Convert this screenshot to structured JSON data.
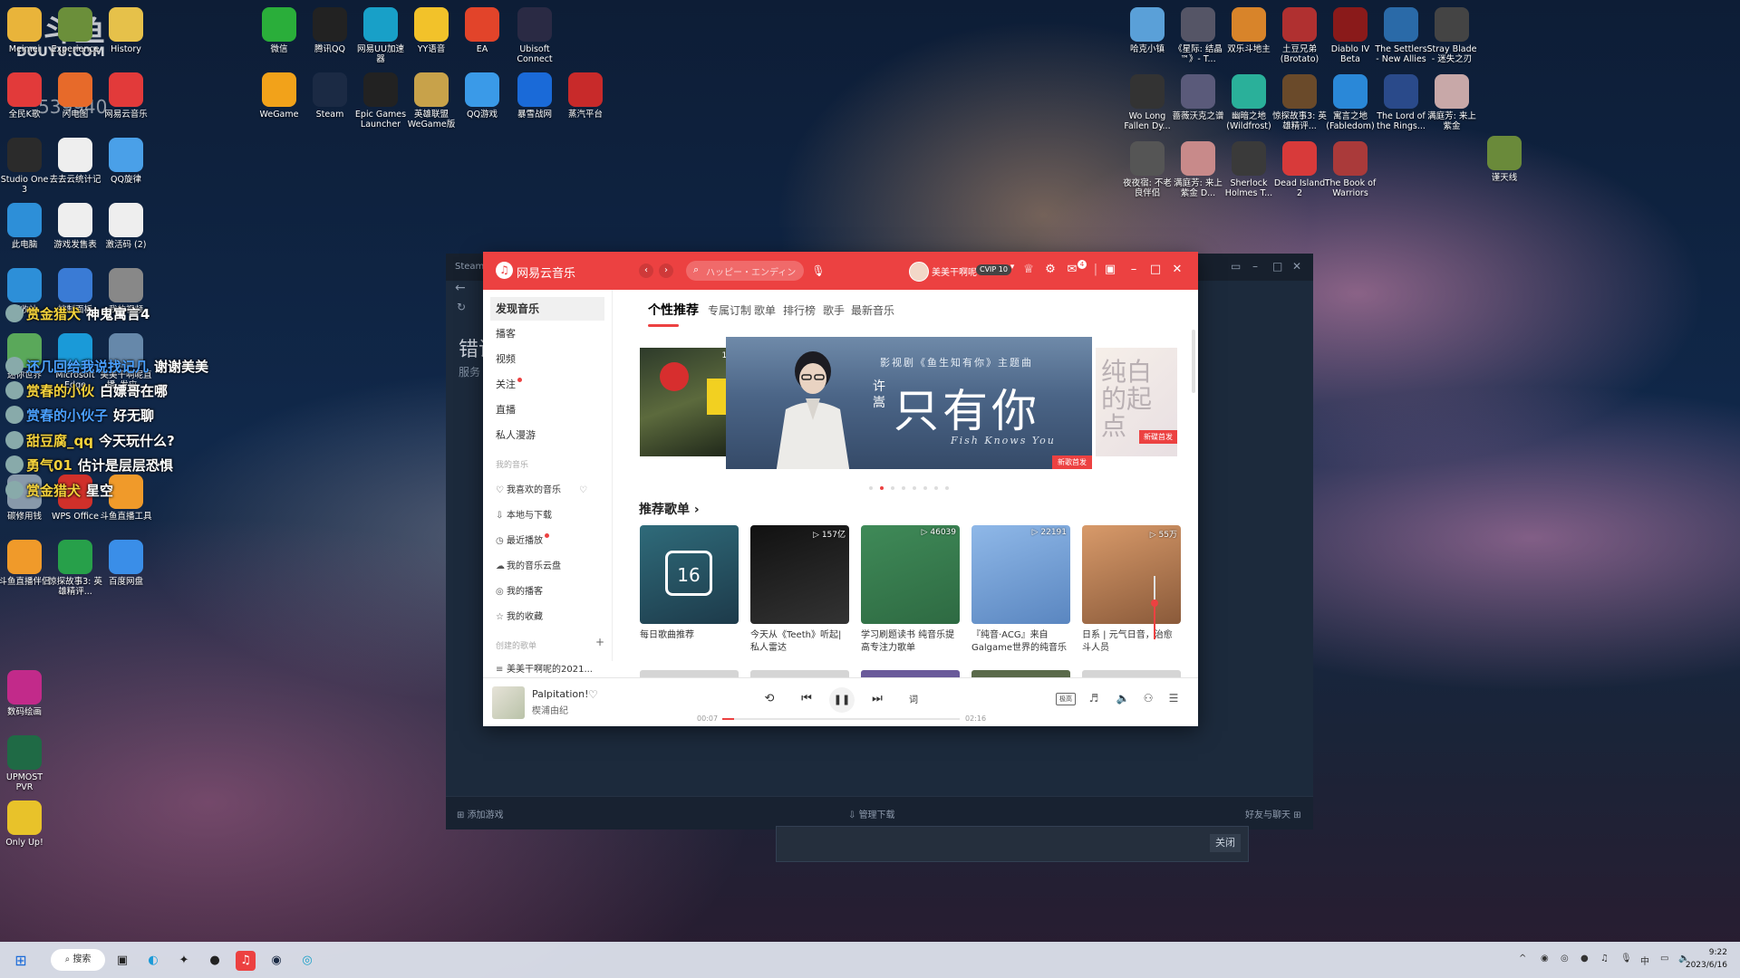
{
  "watermark": {
    "brand": "斗鱼",
    "site": "DOUYU.COM",
    "room": "539940"
  },
  "desktop_left": [
    {
      "label": "Meimei",
      "color": "#e9b43a"
    },
    {
      "label": "Experience",
      "color": "#6b8f3a"
    },
    {
      "label": "History",
      "color": "#e6c14a"
    },
    {
      "label": "全民K歌",
      "color": "#e23a3a"
    },
    {
      "label": "闪电图",
      "color": "#e76a2a"
    },
    {
      "label": "网易云音乐",
      "color": "#e23a3a"
    },
    {
      "label": "Studio One 3",
      "color": "#2b2b2b"
    },
    {
      "label": "去去云统计记",
      "color": "#eeeeee"
    },
    {
      "label": "QQ旋律",
      "color": "#4aa0e8"
    },
    {
      "label": "此电脑",
      "color": "#2d8fd8"
    },
    {
      "label": "游戏发售表",
      "color": "#eeeeee"
    },
    {
      "label": "激活码 (2)",
      "color": "#eeeeee"
    },
    {
      "label": "回收站",
      "color": "#2d8fd8"
    },
    {
      "label": "控制面板",
      "color": "#3a7bd5"
    },
    {
      "label": "我的视频",
      "color": "#888888"
    },
    {
      "label": "迷你世界",
      "color": "#5aa85a"
    },
    {
      "label": "Microsoft Edge",
      "color": "#1a9ad8"
    },
    {
      "label": "美美干啊呢直播_发应...",
      "color": "#6688aa"
    },
    {
      "label": "碳修用钱",
      "color": "#8899aa"
    },
    {
      "label": "WPS Office",
      "color": "#d0302a"
    },
    {
      "label": "斗鱼直播工具",
      "color": "#f09a2a"
    },
    {
      "label": "斗鱼直播伴侣",
      "color": "#f09a2a"
    },
    {
      "label": "惊探故事3: 英雄精评...",
      "color": "#27a04a"
    },
    {
      "label": "百度网盘",
      "color": "#3a8ee8"
    },
    {
      "label": "数码绘画",
      "color": "#c22a8a"
    },
    {
      "label": "UPMOST PVR",
      "color": "#1f6a45"
    },
    {
      "label": "Only Up!",
      "color": "#e8c22a"
    }
  ],
  "desktop_top": [
    {
      "label": "微信",
      "color": "#2aae3a"
    },
    {
      "label": "腾讯QQ",
      "color": "#222222"
    },
    {
      "label": "网易UU加速器",
      "color": "#18a0c8"
    },
    {
      "label": "YY语音",
      "color": "#f2c22a"
    },
    {
      "label": "EA",
      "color": "#e2442a"
    },
    {
      "label": "Ubisoft Connect",
      "color": "#2a2a44"
    },
    {
      "label": "WeGame",
      "color": "#f2a21a"
    },
    {
      "label": "Steam",
      "color": "#1b2a44"
    },
    {
      "label": "Epic Games Launcher",
      "color": "#222222"
    },
    {
      "label": "英雄联盟WeGame版",
      "color": "#c8a24a"
    },
    {
      "label": "QQ游戏",
      "color": "#3a9ae8"
    },
    {
      "label": "暴雪战网",
      "color": "#1a6ad8"
    },
    {
      "label": "蒸汽平台",
      "color": "#c82a2a"
    }
  ],
  "desktop_right": [
    {
      "label": "哈克小镇",
      "color": "#5aa0d8"
    },
    {
      "label": "《星际: 结晶™》- T...",
      "color": "#555566"
    },
    {
      "label": "双乐斗地主",
      "color": "#d8842a"
    },
    {
      "label": "土豆兄弟 (Brotato)",
      "color": "#b03030"
    },
    {
      "label": "Diablo IV Beta",
      "color": "#8a1a1a"
    },
    {
      "label": "The Settlers - New Allies",
      "color": "#2a6aa8"
    },
    {
      "label": "Stray Blade - 迷失之刃",
      "color": "#444444"
    },
    {
      "label": "Wo Long Fallen Dy...",
      "color": "#333333"
    },
    {
      "label": "蔷薇沃克之谱",
      "color": "#5a5a7a"
    },
    {
      "label": "幽暗之地 (Wildfrost)",
      "color": "#2ab09a"
    },
    {
      "label": "惊探故事3: 英雄精评...",
      "color": "#6a4a2a"
    },
    {
      "label": "寓言之地 (Fabledom)",
      "color": "#2a88d8"
    },
    {
      "label": "The Lord of the Rings...",
      "color": "#2a4a8a"
    },
    {
      "label": "满庭芳: 来上紫金",
      "color": "#c8a8a8"
    },
    {
      "label": "夜夜宿: 不老良伴侣",
      "color": "#555555"
    },
    {
      "label": "满庭芳: 来上紫金 D...",
      "color": "#c88a8a"
    },
    {
      "label": "Sherlock Holmes T...",
      "color": "#3a3a3a"
    },
    {
      "label": "Dead Island 2",
      "color": "#d83a3a"
    },
    {
      "label": "The Book of Warriors",
      "color": "#aa3a3a"
    },
    {
      "label": "谨天线",
      "color": "#6a8a3a"
    }
  ],
  "danmaku": [
    {
      "user": "赏金猎犬",
      "text": "神鬼寓言4",
      "user_color": "#f4d23c"
    },
    {
      "user": "还几回给我说找记几",
      "text": "谢谢美美",
      "user_color": "#4aa0ff"
    },
    {
      "user": "赏春的小伙",
      "text": "白嫖哥在哪",
      "user_color": "#f4d23c"
    },
    {
      "user": "赏春的小伙子",
      "text": "好无聊",
      "user_color": "#4aa0ff"
    },
    {
      "user": "甜豆腐_qq",
      "text": "今天玩什么?",
      "user_color": "#f4d23c"
    },
    {
      "user": "勇气01",
      "text": "估计是层层恐惧",
      "user_color": "#f4d23c"
    },
    {
      "user": "赏金猎犬",
      "text": "星空",
      "user_color": "#f4d23c"
    }
  ],
  "steam": {
    "tab": "Steam",
    "error_title": "错误",
    "error_sub": "服务",
    "bottom_add": "添加游戏",
    "bottom_download": "管理下载",
    "bottom_friends": "好友与聊天",
    "dialog_close": "关闭"
  },
  "ncm": {
    "app_name": "网易云音乐",
    "search_placeholder": "ハッピー・エンディン",
    "user_name": "美美干啊呢",
    "vip": "CVIP 10",
    "mail_badge": "4",
    "sidebar": {
      "discover": "发现音乐",
      "items": [
        "播客",
        "视频",
        "关注",
        "直播",
        "私人漫游"
      ],
      "my_music_header": "我的音乐",
      "my_music": [
        "我喜欢的音乐",
        "本地与下载",
        "最近播放",
        "我的音乐云盘",
        "我的播客",
        "我的收藏"
      ],
      "created_header": "创建的歌单",
      "created_first": "美美干啊呢的2021..."
    },
    "tabs": [
      "个性推荐",
      "专属订制",
      "歌单",
      "排行榜",
      "歌手",
      "最新音乐"
    ],
    "banner": {
      "left_count": "10",
      "subtitle": "影视剧《鱼生知有你》主题曲",
      "artist_side": "许嵩",
      "title": "只有你",
      "title_en": "Fish Knows You",
      "tag": "新歌首发",
      "right_text": "纯白的起点",
      "right_tag": "新碟首发"
    },
    "section_title": "推荐歌单",
    "playlists": [
      {
        "title": "每日歌曲推荐",
        "count": "",
        "day": "16",
        "color1": "#2f6b7a",
        "color2": "#1d3a4a"
      },
      {
        "title": "今天从《Teeth》听起|私人雷达",
        "count": "157亿",
        "day": "",
        "color1": "#111111",
        "color2": "#333333"
      },
      {
        "title": "学习刷题读书 纯音乐提高专注力歌单",
        "count": "46039",
        "day": "",
        "color1": "#3f8a58",
        "color2": "#2e6a42"
      },
      {
        "title": "『纯音·ACG』来自Galgame世界的纯音乐",
        "count": "22191",
        "day": "",
        "color1": "#8fb8e8",
        "color2": "#5a86c0"
      },
      {
        "title": "日系 | 元气日音，治愈斗人员",
        "count": "55万",
        "day": "",
        "color1": "#d89a6a",
        "color2": "#8a5a3a"
      }
    ],
    "player": {
      "song": "Palpitation!",
      "artist": "楔浦由纪",
      "current": "00:07",
      "total": "02:16",
      "progress": 0.05,
      "lyric": "词",
      "quality": "极高"
    }
  },
  "taskbar": {
    "search": "搜索",
    "time": "9:22",
    "date": "2023/6/16"
  }
}
